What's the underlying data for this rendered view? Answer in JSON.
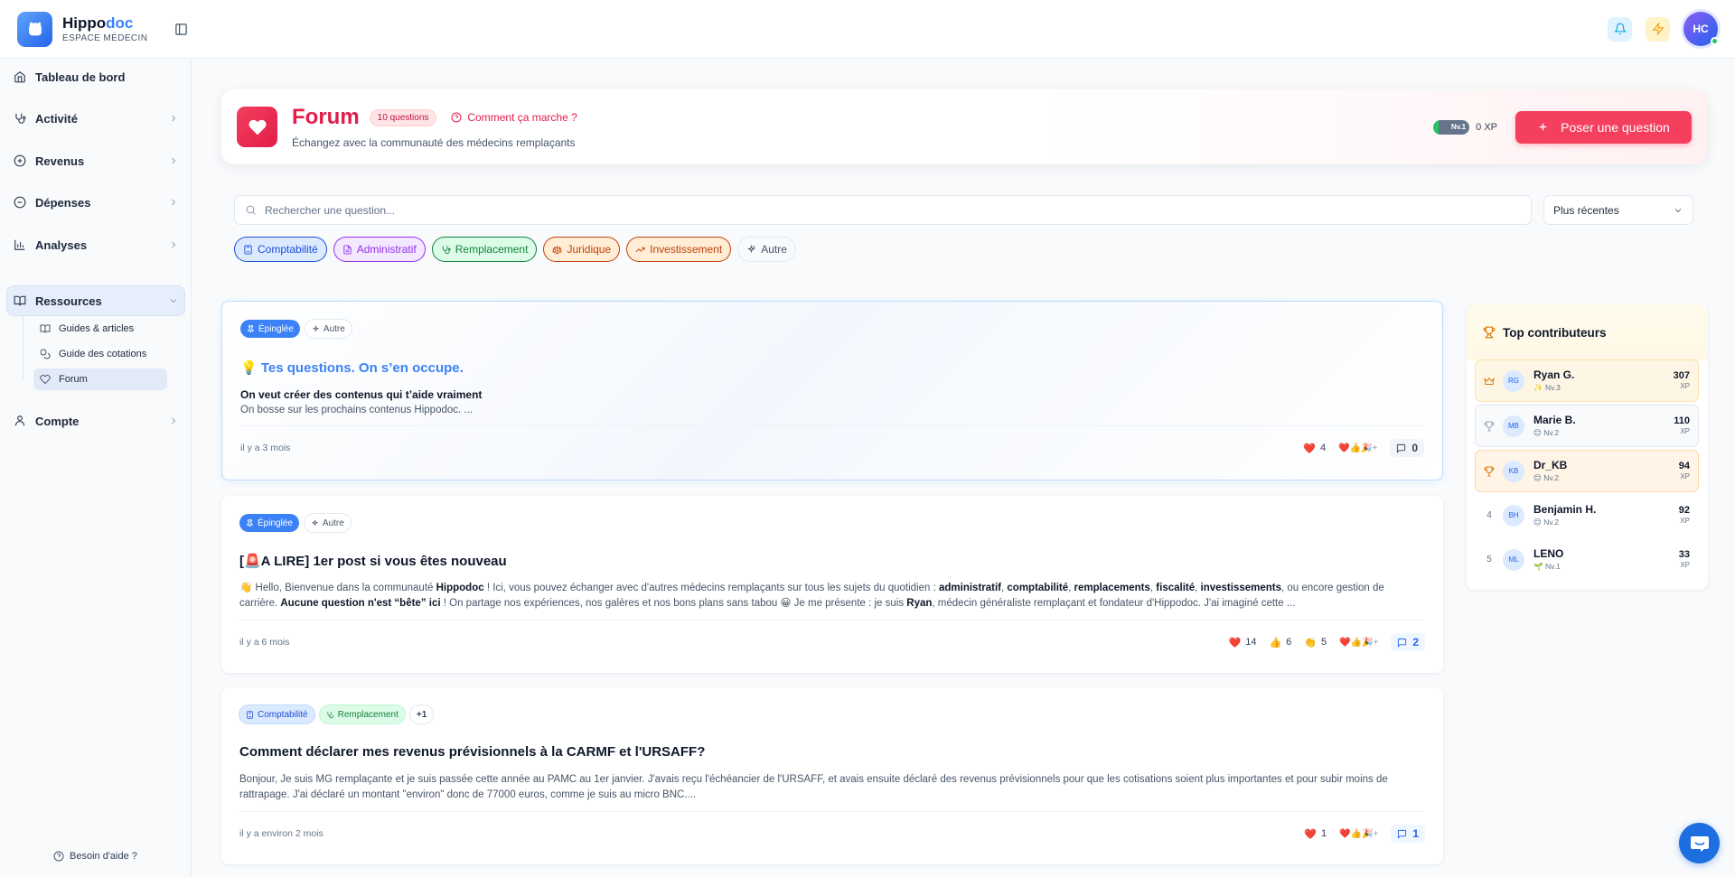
{
  "brand": {
    "name_a": "Hippo",
    "name_b": "doc",
    "subtitle": "ESPACE MÉDECIN"
  },
  "topbar": {
    "avatar_initials": "HC"
  },
  "sidebar": {
    "items": [
      {
        "label": "Tableau de bord",
        "icon": "home-icon"
      },
      {
        "label": "Activité",
        "icon": "stethoscope-icon"
      },
      {
        "label": "Revenus",
        "icon": "plus-circle-icon"
      },
      {
        "label": "Dépenses",
        "icon": "minus-circle-icon"
      },
      {
        "label": "Analyses",
        "icon": "bar-chart-icon"
      },
      {
        "label": "Ressources",
        "icon": "book-open-icon"
      },
      {
        "label": "Compte",
        "icon": "user-icon"
      }
    ],
    "sub_items": [
      {
        "label": "Guides & articles",
        "icon": "book-icon"
      },
      {
        "label": "Guide des cotations",
        "icon": "coins-icon"
      },
      {
        "label": "Forum",
        "icon": "heart-icon"
      }
    ],
    "help": "Besoin d'aide ?"
  },
  "hero": {
    "title": "Forum",
    "count_badge": "10 questions",
    "how_it_works": "Comment ça marche ?",
    "subtitle": "Échangez avec la communauté des médecins remplaçants",
    "level": "Nv.1",
    "xp": "0 XP",
    "ask_button": "Poser une question"
  },
  "search": {
    "placeholder": "Rechercher une question...",
    "sort": "Plus récentes"
  },
  "categories": [
    {
      "label": "Comptabilité",
      "color": "#1d4ed8",
      "bg": "#dbeafe",
      "icon": "calculator-icon"
    },
    {
      "label": "Administratif",
      "color": "#9333ea",
      "bg": "#f3e8ff",
      "icon": "file-icon"
    },
    {
      "label": "Remplacement",
      "color": "#15803d",
      "bg": "#dcfce7",
      "icon": "stethoscope-icon"
    },
    {
      "label": "Juridique",
      "color": "#c2410c",
      "bg": "#ffedd5",
      "icon": "scale-icon"
    },
    {
      "label": "Investissement",
      "color": "#c2410c",
      "bg": "#ffedd5",
      "icon": "trending-up-icon"
    },
    {
      "label": "Autre",
      "color": "#475569",
      "bg": "#f8fafc",
      "icon": "sparkle-icon"
    }
  ],
  "posts": [
    {
      "tags": [
        "Épinglée",
        "Autre"
      ],
      "title": "💡 Tes questions. On s’en occupe.",
      "subtitle": "On veut créer des contenus qui t’aide vraiment",
      "excerpt": "On bosse sur les prochains contenus Hippodoc. ...",
      "time": "il y a 3 mois",
      "reactions": [
        {
          "emoji": "❤️",
          "count": "4"
        }
      ],
      "add_reactions": "❤️👍🎉+",
      "comments": "0"
    },
    {
      "tags": [
        "Épinglée",
        "Autre"
      ],
      "title": "[🚨A LIRE] 1er post si vous êtes nouveau",
      "excerpt": {
        "t1": "👋 Hello, Bienvenue dans la communauté ",
        "b1": "Hippodoc",
        "t2": " ! Ici, vous pouvez échanger avec d'autres médecins remplaçants sur tous les sujets du quotidien : ",
        "b2": "administratif",
        "t3": ", ",
        "b3": "comptabilité",
        "t4": ", ",
        "b4": "remplacements",
        "t5": ", ",
        "b5": "fiscalité",
        "t6": ", ",
        "b6": "investissements",
        "t7": ", ou encore gestion de carrière. ",
        "b7": "Aucune question n'est “bête” ici",
        "t8": " ! On partage nos expériences, nos galères et nos bons plans sans tabou 😀 Je me présente : je suis ",
        "b8": "Ryan",
        "t9": ", médecin généraliste remplaçant et fondateur d'Hippodoc. J'ai imaginé cette ..."
      },
      "time": "il y a 6 mois",
      "reactions": [
        {
          "emoji": "❤️",
          "count": "14"
        },
        {
          "emoji": "👍",
          "count": "6"
        },
        {
          "emoji": "👏",
          "count": "5"
        }
      ],
      "add_reactions": "❤️👍🎉+",
      "comments": "2"
    },
    {
      "tags": [
        "Comptabilité",
        "Remplacement",
        "+1"
      ],
      "title": "Comment déclarer mes revenus prévisionnels à la CARMF et l'URSAFF?",
      "excerpt": "Bonjour, Je suis MG remplaçante et je suis passée cette année au PAMC au 1er janvier. J'avais reçu l'échéancier de l'URSAFF, et avais ensuite déclaré des revenus prévisionnels pour que les cotisations soient plus importantes et pour subir moins de rattrapage. J'ai déclaré un montant \"environ\" donc de 77000 euros, comme je suis au micro BNC....",
      "time": "il y a environ 2 mois",
      "reactions": [
        {
          "emoji": "❤️",
          "count": "1"
        }
      ],
      "add_reactions": "❤️👍🎉+",
      "comments": "1"
    }
  ],
  "contributors": {
    "title": "Top contributeurs",
    "list": [
      {
        "rank": "1",
        "initials": "RG",
        "name": "Ryan G.",
        "level": "✨ Nv.3",
        "xp": "307",
        "unit": "XP"
      },
      {
        "rank": "2",
        "initials": "MB",
        "name": "Marie B.",
        "level": "😊 Nv.2",
        "xp": "110",
        "unit": "XP"
      },
      {
        "rank": "3",
        "initials": "KB",
        "name": "Dr_KB",
        "level": "😊 Nv.2",
        "xp": "94",
        "unit": "XP"
      },
      {
        "rank": "4",
        "initials": "BH",
        "name": "Benjamin H.",
        "level": "😊 Nv.2",
        "xp": "92",
        "unit": "XP"
      },
      {
        "rank": "5",
        "initials": "ML",
        "name": "LENO",
        "level": "🌱 Nv.1",
        "xp": "33",
        "unit": "XP"
      }
    ]
  }
}
